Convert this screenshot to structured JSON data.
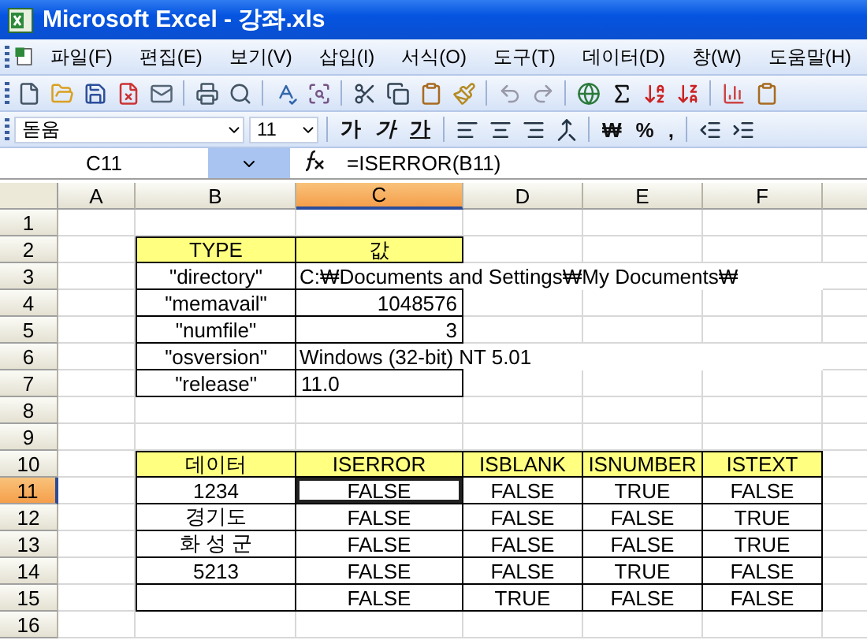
{
  "window": {
    "title": "Microsoft Excel - 강좌.xls"
  },
  "menu": [
    "파일(F)",
    "편집(E)",
    "보기(V)",
    "삽입(I)",
    "서식(O)",
    "도구(T)",
    "데이터(D)",
    "창(W)",
    "도움말(H)"
  ],
  "formatting": {
    "font": "돋움",
    "size": "11",
    "style_buttons": [
      "가",
      "가",
      "가"
    ],
    "number_buttons": [
      "₩",
      "%",
      ","
    ]
  },
  "formula_bar": {
    "name_box": "C11",
    "formula": "=ISERROR(B11)"
  },
  "sheet": {
    "columns": [
      {
        "label": "A",
        "selected": false
      },
      {
        "label": "B",
        "selected": false
      },
      {
        "label": "C",
        "selected": true
      },
      {
        "label": "D",
        "selected": false
      },
      {
        "label": "E",
        "selected": false
      },
      {
        "label": "F",
        "selected": false
      }
    ],
    "rows": [
      {
        "label": "1",
        "selected": false
      },
      {
        "label": "2",
        "selected": false
      },
      {
        "label": "3",
        "selected": false
      },
      {
        "label": "4",
        "selected": false
      },
      {
        "label": "5",
        "selected": false
      },
      {
        "label": "6",
        "selected": false
      },
      {
        "label": "7",
        "selected": false
      },
      {
        "label": "8",
        "selected": false
      },
      {
        "label": "9",
        "selected": false
      },
      {
        "label": "10",
        "selected": false
      },
      {
        "label": "11",
        "selected": true
      },
      {
        "label": "12",
        "selected": false
      },
      {
        "label": "13",
        "selected": false
      },
      {
        "label": "14",
        "selected": false
      },
      {
        "label": "15",
        "selected": false
      },
      {
        "label": "16",
        "selected": false
      }
    ],
    "info_table": {
      "headers": [
        "TYPE",
        "값"
      ],
      "rows": [
        {
          "type": "\"directory\"",
          "value": "C:₩Documents and Settings₩My Documents₩",
          "kind": "text"
        },
        {
          "type": "\"memavail\"",
          "value": "1048576",
          "kind": "number"
        },
        {
          "type": "\"numfile\"",
          "value": "3",
          "kind": "number"
        },
        {
          "type": "\"osversion\"",
          "value": "Windows (32-bit) NT 5.01",
          "kind": "text"
        },
        {
          "type": "\"release\"",
          "value": "11.0",
          "kind": "text"
        }
      ]
    },
    "is_table": {
      "headers": [
        "데이터",
        "ISERROR",
        "ISBLANK",
        "ISNUMBER",
        "ISTEXT"
      ],
      "rows": [
        {
          "data": "1234",
          "values": [
            {
              "text": "FALSE",
              "selected": true
            },
            {
              "text": "FALSE",
              "selected": false
            },
            {
              "text": "TRUE",
              "selected": false
            },
            {
              "text": "FALSE",
              "selected": false
            }
          ]
        },
        {
          "data": "경기도",
          "values": [
            {
              "text": "FALSE",
              "selected": false
            },
            {
              "text": "FALSE",
              "selected": false
            },
            {
              "text": "FALSE",
              "selected": false
            },
            {
              "text": "TRUE",
              "selected": false
            }
          ]
        },
        {
          "data": "화 성 군",
          "values": [
            {
              "text": "FALSE",
              "selected": false
            },
            {
              "text": "FALSE",
              "selected": false
            },
            {
              "text": "FALSE",
              "selected": false
            },
            {
              "text": "TRUE",
              "selected": false
            }
          ]
        },
        {
          "data": "5213",
          "values": [
            {
              "text": "FALSE",
              "selected": false
            },
            {
              "text": "FALSE",
              "selected": false
            },
            {
              "text": "TRUE",
              "selected": false
            },
            {
              "text": "FALSE",
              "selected": false
            }
          ]
        },
        {
          "values": [
            {
              "text": "FALSE",
              "selected": false
            },
            {
              "text": "TRUE",
              "selected": false
            },
            {
              "text": "FALSE",
              "selected": false
            },
            {
              "text": "FALSE",
              "selected": false
            }
          ]
        }
      ]
    }
  }
}
